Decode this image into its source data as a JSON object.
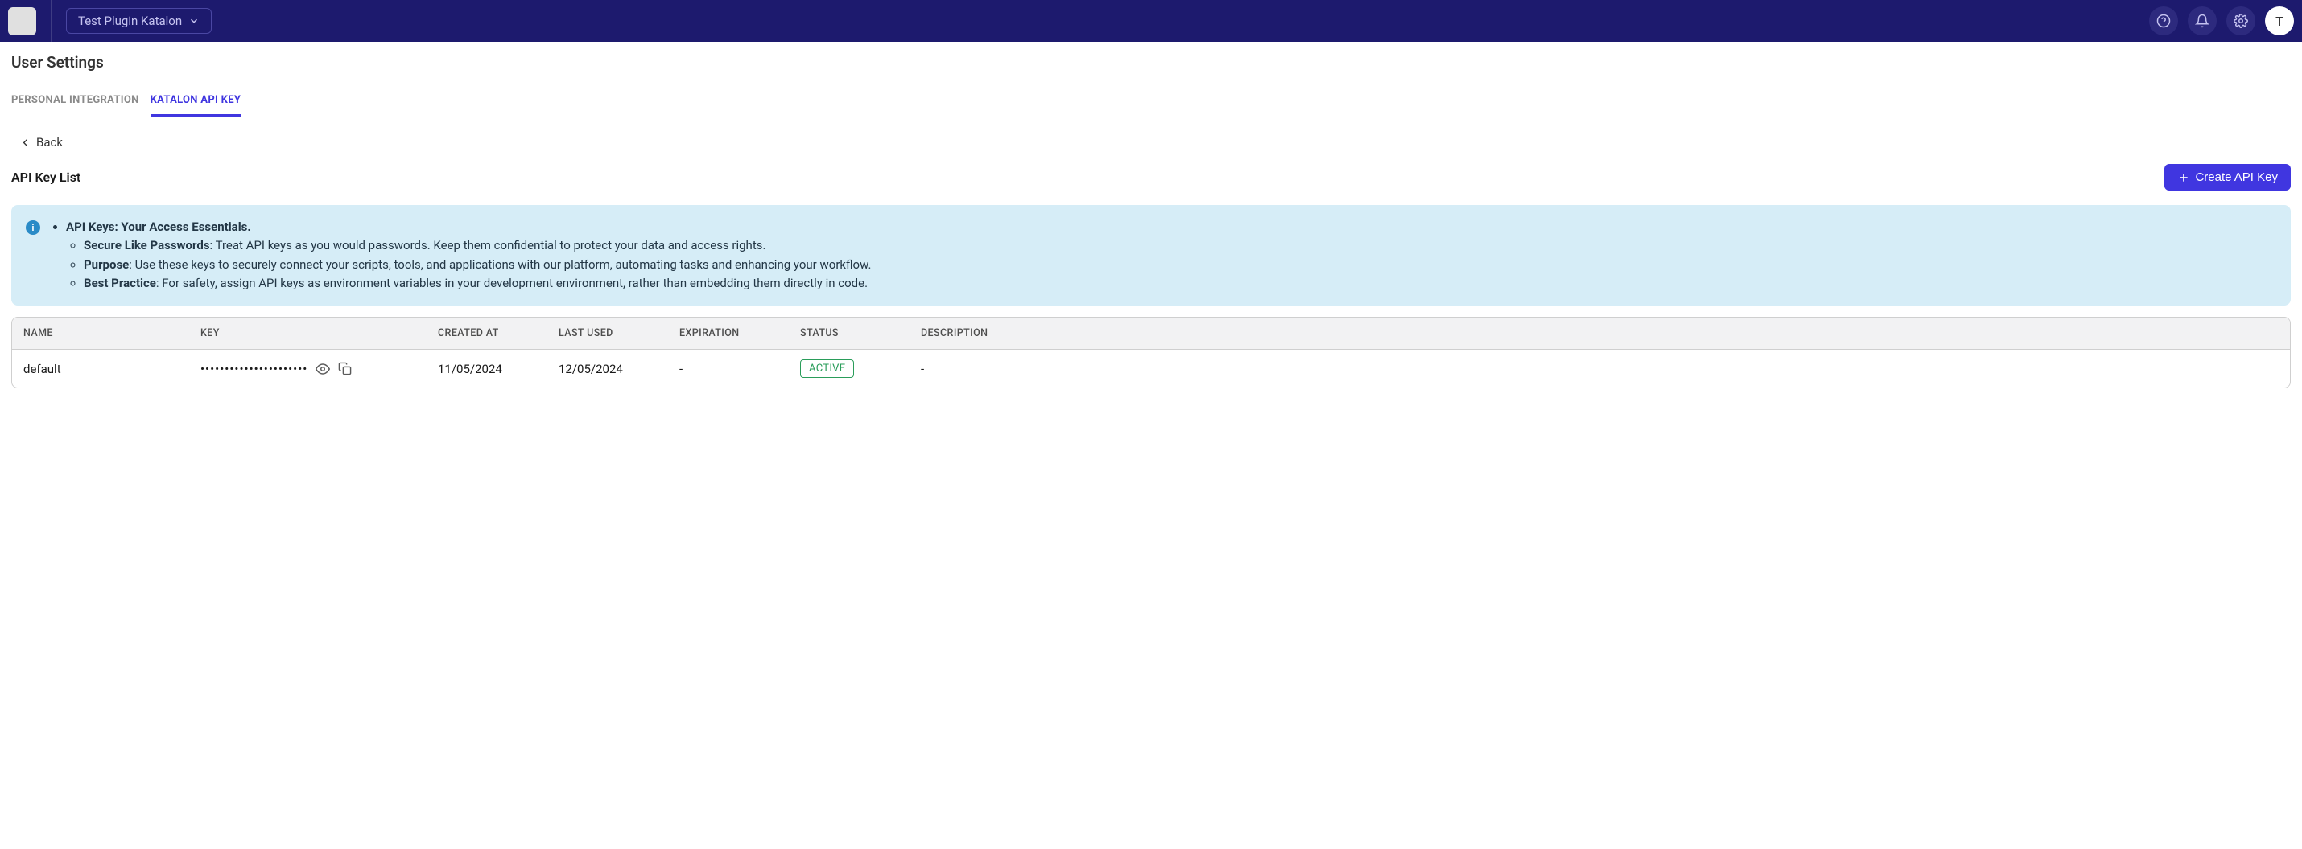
{
  "topbar": {
    "project_name": "Test Plugin Katalon",
    "avatar_letter": "T"
  },
  "page": {
    "title": "User Settings"
  },
  "tabs": [
    {
      "label": "PERSONAL INTEGRATION",
      "active": false
    },
    {
      "label": "KATALON API KEY",
      "active": true
    }
  ],
  "back": {
    "label": "Back"
  },
  "section": {
    "title": "API Key List",
    "create_button": "Create API Key"
  },
  "info": {
    "heading": "API Keys: Your Access Essentials.",
    "items": [
      {
        "bold": "Secure Like Passwords",
        "text": ": Treat API keys as you would passwords. Keep them confidential to protect your data and access rights."
      },
      {
        "bold": "Purpose",
        "text": ": Use these keys to securely connect your scripts, tools, and applications with our platform, automating tasks and enhancing your workflow."
      },
      {
        "bold": "Best Practice",
        "text": ": For safety, assign API keys as environment variables in your development environment, rather than embedding them directly in code."
      }
    ]
  },
  "table": {
    "headers": {
      "name": "NAME",
      "key": "KEY",
      "created_at": "CREATED AT",
      "last_used": "LAST USED",
      "expiration": "EXPIRATION",
      "status": "STATUS",
      "description": "DESCRIPTION"
    },
    "rows": [
      {
        "name": "default",
        "key_mask": "••••••••••••••••••••••",
        "created_at": "11/05/2024",
        "last_used": "12/05/2024",
        "expiration": "-",
        "status": "ACTIVE",
        "description": "-"
      }
    ]
  }
}
